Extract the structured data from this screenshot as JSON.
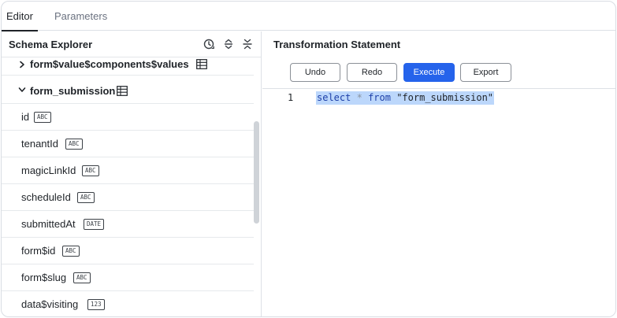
{
  "tabs": [
    {
      "label": "Editor",
      "active": true
    },
    {
      "label": "Parameters",
      "active": false
    }
  ],
  "schema_explorer": {
    "title": "Schema Explorer",
    "header_icons": [
      "history-icon",
      "expand-all-icon",
      "collapse-all-icon"
    ],
    "nodes": [
      {
        "label": "form$value$components$values",
        "expanded": false
      },
      {
        "label": "form_submission",
        "expanded": true
      }
    ],
    "fields": [
      {
        "name": "id",
        "type": "ABC"
      },
      {
        "name": "tenantId",
        "type": "ABC"
      },
      {
        "name": "magicLinkId",
        "type": "ABC"
      },
      {
        "name": "scheduleId",
        "type": "ABC"
      },
      {
        "name": "submittedAt",
        "type": "DATE"
      },
      {
        "name": "form$id",
        "type": "ABC"
      },
      {
        "name": "form$slug",
        "type": "ABC"
      },
      {
        "name": "data$visiting",
        "type": "123"
      }
    ]
  },
  "transformation": {
    "title": "Transformation Statement",
    "buttons": {
      "undo": "Undo",
      "redo": "Redo",
      "execute": "Execute",
      "export": "Export"
    },
    "line_number": "1",
    "code": {
      "kw1": "select",
      "op": "*",
      "kw2": "from",
      "table": "\"form_submission\""
    }
  },
  "colors": {
    "accent": "#2563eb",
    "selection": "#bcd7fb",
    "keyword": "#1d3fa8"
  }
}
